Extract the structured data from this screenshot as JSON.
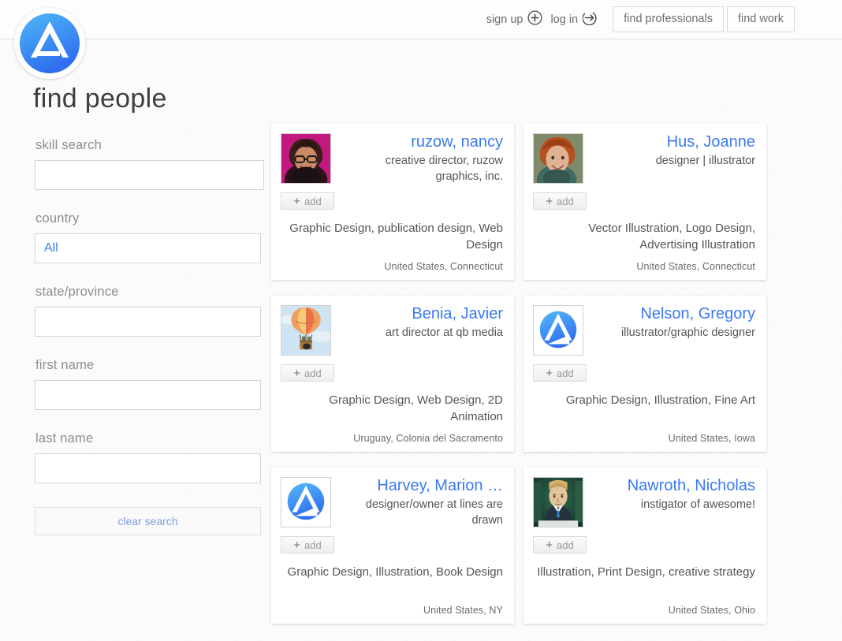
{
  "header": {
    "sign_up_label": "sign up",
    "sign_up_icon": "plus-circle-icon",
    "log_in_label": "log in",
    "log_in_icon": "arrow-right-circle-icon",
    "nav_buttons": [
      {
        "label": "find professionals"
      },
      {
        "label": "find work"
      }
    ]
  },
  "logo": {
    "name": "site-logo",
    "icon": "letter-a-circle-logo",
    "color": "#3b9cf5"
  },
  "page": {
    "title": "find people"
  },
  "sidebar": {
    "skill_search": {
      "label": "skill search",
      "value": "",
      "placeholder": ""
    },
    "country": {
      "label": "country",
      "value": "All"
    },
    "state_province": {
      "label": "state/province",
      "value": "",
      "placeholder": ""
    },
    "first_name": {
      "label": "first name",
      "value": "",
      "placeholder": ""
    },
    "last_name": {
      "label": "last name",
      "value": "",
      "placeholder": ""
    },
    "clear_button": {
      "label": "clear search"
    },
    "link_color": "#3b7af0"
  },
  "results": {
    "add_label": "add",
    "add_icon": "plus-icon",
    "cards": [
      {
        "name": "ruzow, nancy",
        "title": "creative director, ruzow graphics, inc.",
        "skills": "Graphic Design, publication design, Web Design",
        "location": "United States, Connecticut",
        "avatar": "photo-woman-glasses"
      },
      {
        "name": "Hus, Joanne",
        "title": "designer | illustrator",
        "skills": "Vector Illustration, Logo Design, Advertising Illustration",
        "location": "United States, Connecticut",
        "avatar": "photo-woman-red-hair"
      },
      {
        "name": "Benia, Javier",
        "title": "art director at qb media",
        "skills": "Graphic Design, Web Design, 2D Animation",
        "location": "Uruguay, Colonia del Sacramento",
        "avatar": "photo-hot-air-balloon"
      },
      {
        "name": "Nelson, Gregory",
        "title": "illustrator/graphic designer",
        "skills": "Graphic Design, Illustration, Fine Art",
        "location": "United States, Iowa",
        "avatar": "default-logo-avatar"
      },
      {
        "name": "Harvey, Marion …",
        "title": "designer/owner at lines are drawn",
        "skills": "Graphic Design, Illustration, Book Design",
        "location": "United States, NY",
        "avatar": "default-logo-avatar"
      },
      {
        "name": "Nawroth, Nicholas",
        "title": "instigator of awesome!",
        "skills": "Illustration, Print Design, creative strategy",
        "location": "United States, Ohio",
        "avatar": "illustration-man-portrait"
      }
    ]
  }
}
